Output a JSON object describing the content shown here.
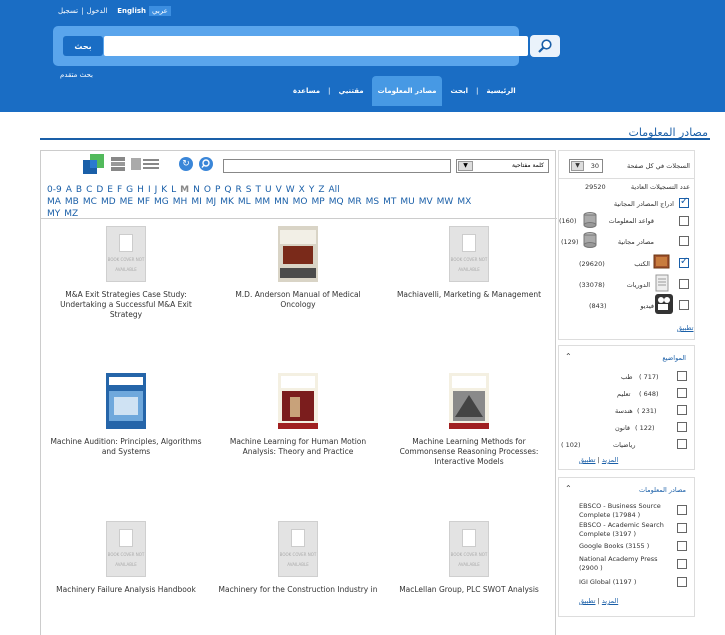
{
  "header": {
    "lang_login": "الدخول",
    "lang_register": "تسجيل",
    "lang_english": "English",
    "lang_arabic": "عربي",
    "search_button": "بحث",
    "search_placeholder": "",
    "advanced_search": "بحث متقدم",
    "nav": [
      "الرئيسية",
      "ابحث",
      "مصادر المعلومات",
      "مقتنيي",
      "مساعدة"
    ],
    "nav_active_index": 2
  },
  "page_title": "مصادر المعلومات",
  "toolbar": {
    "keyword_select": "كلمة مفتاحية",
    "keyword_value": ""
  },
  "alphabet": {
    "row1": [
      "0-9",
      "A",
      "B",
      "C",
      "D",
      "E",
      "F",
      "G",
      "H",
      "I",
      "J",
      "K",
      "L",
      "M",
      "N",
      "O",
      "P",
      "Q",
      "R",
      "S",
      "T",
      "U",
      "V",
      "W",
      "X",
      "Y",
      "Z",
      "All"
    ],
    "row2": [
      "MA",
      "MB",
      "MC",
      "MD",
      "ME",
      "MF",
      "MG",
      "MH",
      "MI",
      "MJ",
      "MK",
      "ML",
      "MM",
      "MN",
      "MO",
      "MP",
      "MQ",
      "MR",
      "MS",
      "MT",
      "MU",
      "MV",
      "MW",
      "MX"
    ],
    "row3": [
      "MY",
      "MZ"
    ],
    "current": "M"
  },
  "books": [
    {
      "title": "M&A Exit Strategies Case Study: Undertaking a Successful M&A Exit Strategy",
      "cover": "blank"
    },
    {
      "title": "M.D. Anderson Manual of Medical Oncology",
      "cover": "MD ANDERSON MANUAL OF MEDICAL ONCOLOGY"
    },
    {
      "title": "Machiavelli, Marketing & Management",
      "cover": "blank"
    },
    {
      "title": "Machine Audition: Principles, Algorithms and Systems",
      "cover": "MACHINE AUDITION"
    },
    {
      "title": "Machine Learning for Human Motion Analysis: Theory and Practice",
      "cover": "Machine Learning for Human Motion Analysis"
    },
    {
      "title": "Machine Learning Methods for Commonsense Reasoning Processes: Interactive Models",
      "cover": "Machine Learning Methods for Commonsense Reasoning Processes"
    },
    {
      "title": "Machinery Failure Analysis Handbook",
      "cover": "blank"
    },
    {
      "title": "Machinery for the Construction Industry in Australia: A Strategic",
      "cover": "blank"
    },
    {
      "title": "MacLellan Group, PLC SWOT Analysis",
      "cover": "blank"
    }
  ],
  "blank_cover_text": "BOOK COVER NOT AVAILABLE",
  "sidebar": {
    "per_page_label": "السجلات في كل صفحة",
    "per_page_value": "30",
    "total_label": "عدد التسجيلات العادية",
    "total_value": "29520",
    "resource_types": [
      {
        "label": "ادراج المصادر المجانية",
        "count": "",
        "checked": true,
        "icon": ""
      },
      {
        "label": "قواعد المعلومات",
        "count": "(160)",
        "checked": false,
        "icon": "database-icon"
      },
      {
        "label": "مصادر مجانية",
        "count": "(129)",
        "checked": false,
        "icon": "database-icon"
      },
      {
        "label": "الكتب",
        "count": "(29620)",
        "checked": true,
        "icon": "book-icon"
      },
      {
        "label": "الدوريات",
        "count": "(33078)",
        "checked": false,
        "icon": "journal-icon"
      },
      {
        "label": "فيديو",
        "count": "(843)",
        "checked": false,
        "icon": "video-icon"
      }
    ],
    "apply": "تطبيق",
    "more": "المزيد",
    "subjects_title": "المواضيع",
    "subjects": [
      {
        "label": "طب",
        "count": "( 717)"
      },
      {
        "label": "تعليم",
        "count": "( 648)"
      },
      {
        "label": "هندسة",
        "count": "( 231)"
      },
      {
        "label": "قانون",
        "count": "( 122)"
      },
      {
        "label": "رياضيات",
        "count": "( 102)"
      }
    ],
    "sources_title": "مصادر المعلومات",
    "sources": [
      {
        "line1": "EBSCO - Business Source",
        "line2": "Complete (17984 )"
      },
      {
        "line1": "EBSCO - Academic Search",
        "line2": "Complete (3197 )"
      },
      {
        "line1": "Google Books (3155 )",
        "line2": ""
      },
      {
        "line1": "National Academy Press",
        "line2": "(2900 )"
      },
      {
        "line1": "IGI Global (1197 )",
        "line2": ""
      }
    ]
  }
}
